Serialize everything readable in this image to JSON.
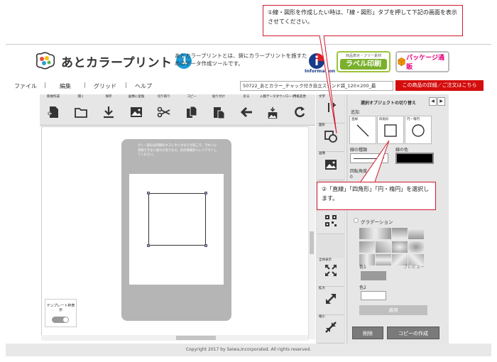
{
  "header": {
    "logo_text": "あとカラープリント",
    "logo_badge": "1",
    "tagline": "あとカラープリントとは、袋にカラープリントを施すためのデータ作成ツールです。",
    "info_label": "Information",
    "banner1_top": "商品表示・フリー素材",
    "banner1_main": "ラベル印刷",
    "banner2_text": "パッケージ通販"
  },
  "menu": {
    "file": "ファイル",
    "sep1": "|",
    "edit": "編集",
    "sep2": "|",
    "grid": "グリッド",
    "sep3": "|",
    "help": "ヘルプ",
    "product": "50722_あとカラー_チャック付き自立スタンド袋_120×200_最",
    "order": "この商品の詳細／ご注文はこちら"
  },
  "toolbar": {
    "new": "新規作成",
    "open": "開く",
    "save": "保存",
    "image_convert": "画像に変換",
    "cut": "切り取り",
    "copy": "コピー",
    "paste": "貼り付け",
    "back": "戻る",
    "download": "入稿データダウンロード",
    "refresh": "用紙変更"
  },
  "canvas": {
    "bag_note": "グレー部分は印刷のネスレやシボなどが起こり、きれいに印刷できない恐れがあります。白の領域内へレイアウトしてください。",
    "template_label": "テンプレート枠表示"
  },
  "side": {
    "text_label": "文字",
    "shape_label": "図形",
    "image_label": "画像",
    "fullview_label": "全体表示",
    "zoomin_label": "拡大",
    "zoomout_label": "縮小"
  },
  "panel": {
    "title": "選択オブジェクトの切り替え",
    "add": "追加",
    "shape_line": "直線",
    "shape_rect": "四角形",
    "shape_circle": "円・楕円",
    "line_type": "線の種類",
    "line_color": "線の色",
    "rotation": "回転角度",
    "rotation_value": "0",
    "gradient": "グラデーション",
    "color1": "色1",
    "preview": "プレビュー",
    "color2": "色2",
    "apply": "適用",
    "delete": "削除",
    "copy": "コピーの作成"
  },
  "callouts": {
    "c1": "①線・図形を作成したい時は、「線・図形」タブを押して下記の画面を表示させてください。",
    "c2": "②「直線」「四角形」「円・楕円」を選択します。"
  },
  "footer": "Copyright 2017 by Seiwa,Incorporated. All rights reserved."
}
